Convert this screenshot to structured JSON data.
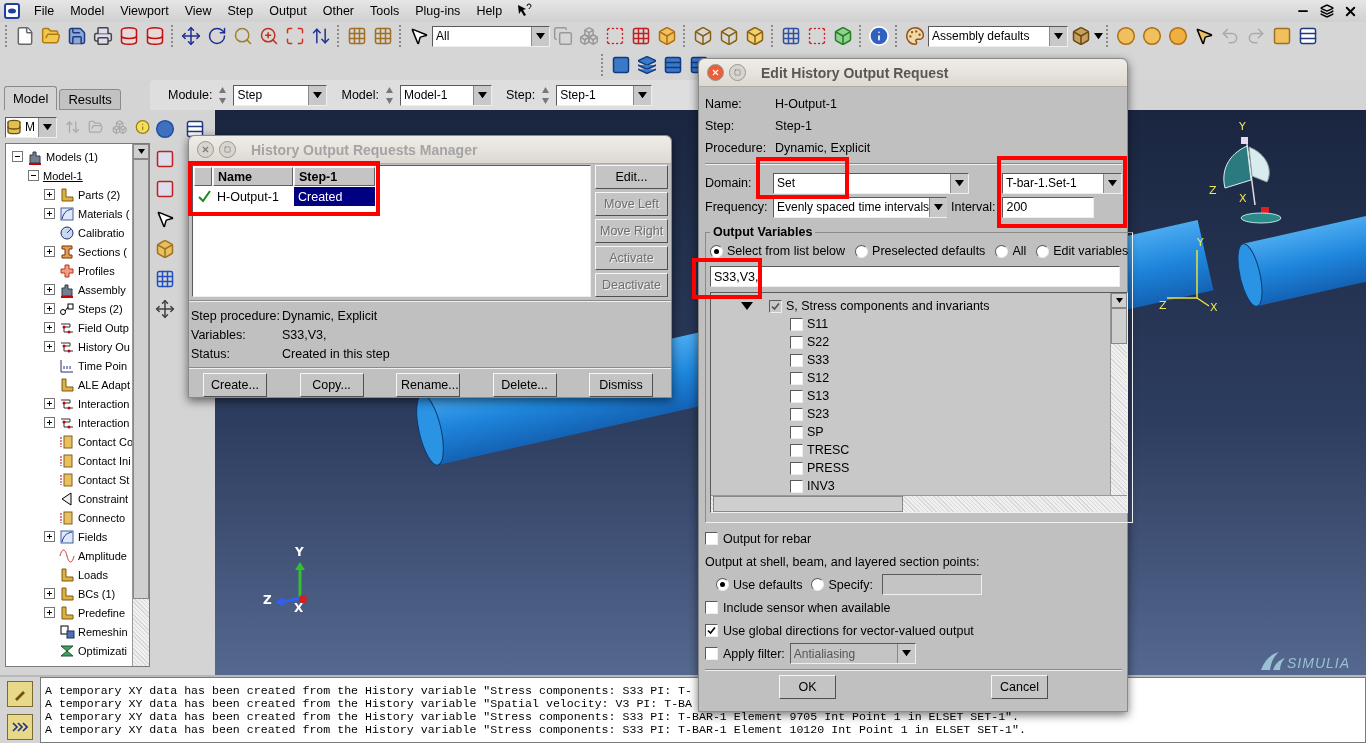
{
  "menu": [
    "File",
    "Model",
    "Viewport",
    "View",
    "Step",
    "Output",
    "Other",
    "Tools",
    "Plug-ins",
    "Help"
  ],
  "toolbar": {
    "selection_filter": "All",
    "render_style": "Assembly defaults"
  },
  "side_tabs": [
    {
      "label": "Model",
      "selected": true
    },
    {
      "label": "Results",
      "selected": false
    }
  ],
  "context_bar": {
    "module_label": "Module:",
    "module": "Step",
    "model_label": "Model:",
    "model": "Model-1",
    "step_label": "Step:",
    "step": "Step-1"
  },
  "tree": {
    "filter": "M",
    "root": {
      "label": "Models (1)",
      "kind": "open",
      "children": [
        {
          "label": "Model-1",
          "kind": "open",
          "current": true,
          "children": [
            {
              "label": "Parts (2)",
              "kind": "closed"
            },
            {
              "label": "Materials (",
              "kind": "closed"
            },
            {
              "label": "Calibratio",
              "kind": "leaf"
            },
            {
              "label": "Sections (",
              "kind": "closed"
            },
            {
              "label": "Profiles",
              "kind": "leaf"
            },
            {
              "label": "Assembly",
              "kind": "closed"
            },
            {
              "label": "Steps (2)",
              "kind": "closed"
            },
            {
              "label": "Field Outp",
              "kind": "closed"
            },
            {
              "label": "History Ou",
              "kind": "closed"
            },
            {
              "label": "Time Poin",
              "kind": "leaf"
            },
            {
              "label": "ALE Adapt",
              "kind": "leaf"
            },
            {
              "label": "Interaction",
              "kind": "closed"
            },
            {
              "label": "Interaction",
              "kind": "closed"
            },
            {
              "label": "Contact Co",
              "kind": "leaf"
            },
            {
              "label": "Contact Ini",
              "kind": "leaf"
            },
            {
              "label": "Contact St",
              "kind": "leaf"
            },
            {
              "label": "Constraint",
              "kind": "leaf"
            },
            {
              "label": "Connecto",
              "kind": "leaf"
            },
            {
              "label": "Fields",
              "kind": "closed"
            },
            {
              "label": "Amplitude",
              "kind": "leaf"
            },
            {
              "label": "Loads",
              "kind": "leaf"
            },
            {
              "label": "BCs (1)",
              "kind": "closed"
            },
            {
              "label": "Predefine",
              "kind": "closed"
            },
            {
              "label": "Remeshin",
              "kind": "leaf"
            },
            {
              "label": "Optimizati",
              "kind": "leaf"
            }
          ]
        }
      ]
    }
  },
  "viewport": {
    "triads": [
      {
        "labels": [
          "Y",
          "Z",
          "X"
        ]
      },
      {
        "labels": [
          "Y",
          "Z",
          "X"
        ]
      },
      {
        "labels": [
          "Y",
          "Z",
          "X"
        ]
      }
    ],
    "logo": "SIMULIA"
  },
  "messages": [
    "A temporary XY data has been created from the History variable \"Stress components: S33 PI: T-",
    "A temporary XY data has been created from the History variable \"Spatial velocity: V3 PI: T-BA",
    "A temporary XY data has been created from the History variable \"Stress components: S33 PI: T-BAR-1 Element 9705 Int Point 1 in ELSET SET-1\".",
    "A temporary XY data has been created from the History variable \"Stress components: S33 PI: T-BAR-1 Element 10120 Int Point 1 in ELSET SET-1\"."
  ],
  "history_manager": {
    "title": "History Output Requests Manager",
    "highlighted": true,
    "columns": [
      "Name",
      "Step-1"
    ],
    "rows": [
      {
        "active": true,
        "name": "H-Output-1",
        "status": "Created",
        "selected": true
      }
    ],
    "side_buttons": [
      {
        "label": "Edit...",
        "disabled": false
      },
      {
        "label": "Move Left",
        "disabled": true
      },
      {
        "label": "Move Right",
        "disabled": true
      },
      {
        "label": "Activate",
        "disabled": true
      },
      {
        "label": "Deactivate",
        "disabled": true
      }
    ],
    "info": [
      {
        "label": "Step procedure:",
        "value": "Dynamic, Explicit"
      },
      {
        "label": "Variables:",
        "value": "S33,V3,"
      },
      {
        "label": "Status:",
        "value": "Created in this step"
      }
    ],
    "buttons": [
      "Create...",
      "Copy...",
      "Rename...",
      "Delete...",
      "Dismiss"
    ]
  },
  "edit_dialog": {
    "title": "Edit History Output Request",
    "info": [
      {
        "label": "Name:",
        "value": "H-Output-1"
      },
      {
        "label": "Step:",
        "value": "Step-1"
      },
      {
        "label": "Procedure:",
        "value": "Dynamic, Explicit"
      }
    ],
    "domain_label": "Domain:",
    "domain": "Set",
    "domain_set": "T-bar-1.Set-1",
    "frequency_label": "Frequency:",
    "frequency": "Evenly spaced time intervals",
    "interval_label": "Interval:",
    "interval": "200",
    "highlights": {
      "domain": true,
      "set_interval": true,
      "variables": true
    },
    "output_variables": {
      "title": "Output Variables",
      "modes": [
        {
          "label": "Select from list below",
          "selected": true
        },
        {
          "label": "Preselected defaults",
          "selected": false
        },
        {
          "label": "All",
          "selected": false
        },
        {
          "label": "Edit variables",
          "selected": false
        }
      ],
      "value": "S33,V3,",
      "group": {
        "label": "S, Stress components and invariants",
        "expanded": true,
        "partial": true,
        "children": [
          {
            "label": "S11",
            "checked": false
          },
          {
            "label": "S22",
            "checked": false
          },
          {
            "label": "S33",
            "checked": false
          },
          {
            "label": "S12",
            "checked": false
          },
          {
            "label": "S13",
            "checked": false
          },
          {
            "label": "S23",
            "checked": false
          },
          {
            "label": "SP",
            "checked": false
          },
          {
            "label": "TRESC",
            "checked": false
          },
          {
            "label": "PRESS",
            "checked": false
          },
          {
            "label": "INV3",
            "checked": false
          }
        ]
      }
    },
    "rebar": {
      "label": "Output for rebar",
      "checked": false
    },
    "section_points": {
      "label": "Output at shell, beam, and layered section points:",
      "options": [
        {
          "label": "Use defaults",
          "selected": true
        },
        {
          "label": "Specify:",
          "selected": false
        }
      ]
    },
    "options": [
      {
        "label": "Include sensor when available",
        "checked": false
      },
      {
        "label": "Use global directions for vector-valued output",
        "checked": true
      }
    ],
    "filter": {
      "label": "Apply filter:",
      "checked": false,
      "value": "Antialiasing"
    },
    "buttons": [
      "OK",
      "Cancel"
    ]
  }
}
